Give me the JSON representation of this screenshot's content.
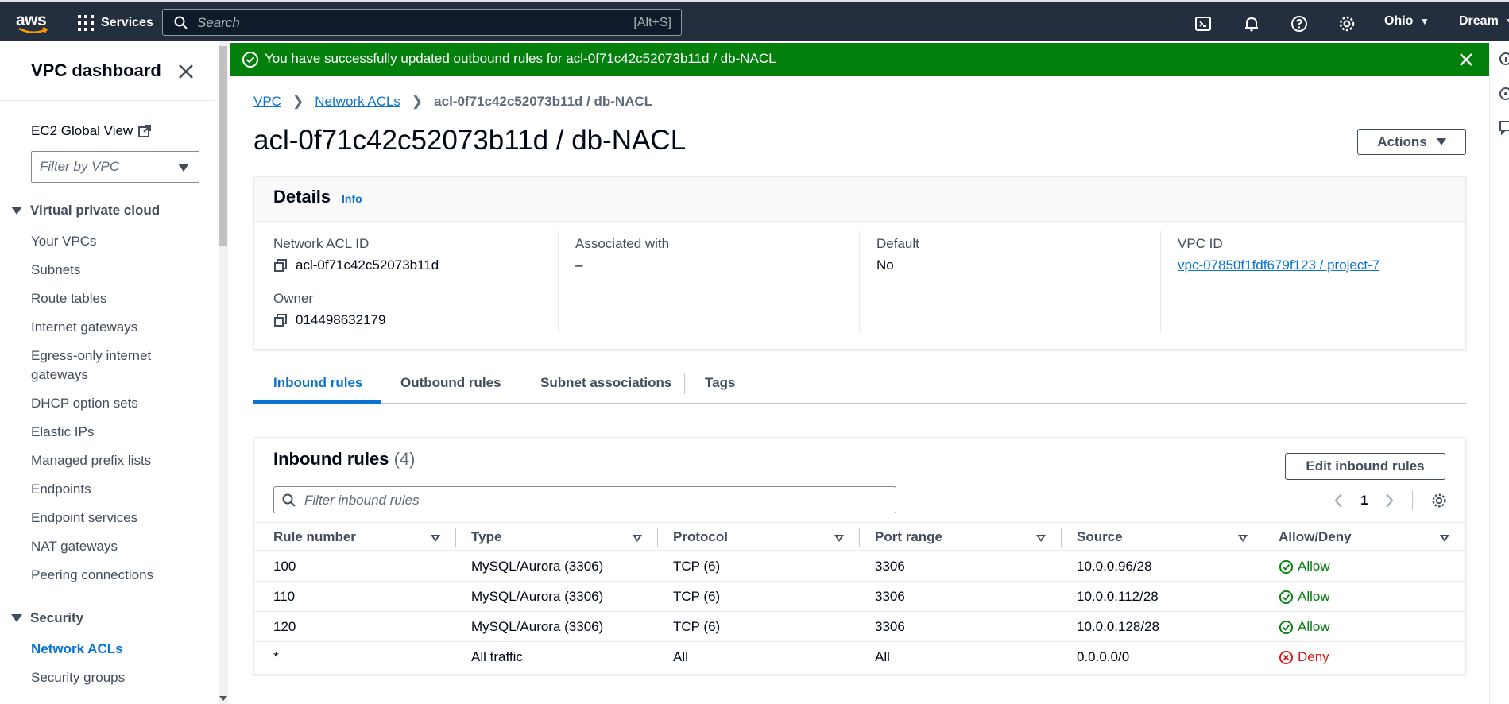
{
  "topbar": {
    "logo": "aws",
    "services_label": "Services",
    "search_placeholder": "Search",
    "search_shortcut": "[Alt+S]",
    "region": "Ohio",
    "account": "Dream"
  },
  "sidebar": {
    "title": "VPC dashboard",
    "ec2_global_view": "EC2 Global View",
    "filter_placeholder": "Filter by VPC",
    "section_vpc": "Virtual private cloud",
    "vpc_items": [
      "Your VPCs",
      "Subnets",
      "Route tables",
      "Internet gateways",
      "Egress-only internet gateways",
      "DHCP option sets",
      "Elastic IPs",
      "Managed prefix lists",
      "Endpoints",
      "Endpoint services",
      "NAT gateways",
      "Peering connections"
    ],
    "section_security": "Security",
    "security_items": [
      "Network ACLs",
      "Security groups"
    ],
    "active_item": "Network ACLs"
  },
  "flash": {
    "message": "You have successfully updated outbound rules for acl-0f71c42c52073b11d / db-NACL",
    "color": "#037f0c"
  },
  "breadcrumb": [
    "VPC",
    "Network ACLs",
    "acl-0f71c42c52073b11d / db-NACL"
  ],
  "page_title": "acl-0f71c42c52073b11d / db-NACL",
  "actions_label": "Actions",
  "details": {
    "title": "Details",
    "info": "Info",
    "network_acl_id_label": "Network ACL ID",
    "network_acl_id": "acl-0f71c42c52073b11d",
    "owner_label": "Owner",
    "owner": "014498632179",
    "associated_label": "Associated with",
    "associated": "–",
    "default_label": "Default",
    "default": "No",
    "vpc_id_label": "VPC ID",
    "vpc_id": "vpc-07850f1fdf679f123 / project-7"
  },
  "tabs": [
    "Inbound rules",
    "Outbound rules",
    "Subnet associations",
    "Tags"
  ],
  "rules": {
    "title": "Inbound rules",
    "count": "(4)",
    "edit_label": "Edit inbound rules",
    "filter_placeholder": "Filter inbound rules",
    "page": "1",
    "columns": [
      "Rule number",
      "Type",
      "Protocol",
      "Port range",
      "Source",
      "Allow/Deny"
    ],
    "rows": [
      [
        "100",
        "MySQL/Aurora (3306)",
        "TCP (6)",
        "3306",
        "10.0.0.96/28",
        "Allow"
      ],
      [
        "110",
        "MySQL/Aurora (3306)",
        "TCP (6)",
        "3306",
        "10.0.0.112/28",
        "Allow"
      ],
      [
        "120",
        "MySQL/Aurora (3306)",
        "TCP (6)",
        "3306",
        "10.0.0.128/28",
        "Allow"
      ],
      [
        "*",
        "All traffic",
        "All",
        "All",
        "0.0.0.0/0",
        "Deny"
      ]
    ]
  }
}
